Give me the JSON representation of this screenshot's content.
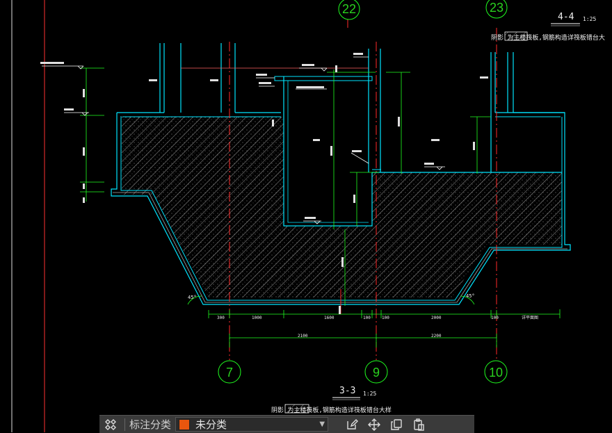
{
  "drawing": {
    "colors": {
      "background": "#000000",
      "concrete_outline": "#00ffff",
      "axis_line": "#ff2020",
      "dimension": "#20ff20",
      "axis_bubble": "#20ff20",
      "wall": "#00e5ff",
      "leader": "#ffffff"
    },
    "top_axes": [
      {
        "label": "22",
        "tag": "axis-22"
      },
      {
        "label": "23",
        "tag": "axis-23"
      }
    ],
    "bottom_axes": [
      {
        "label": "7",
        "tag": "axis-7"
      },
      {
        "label": "9",
        "tag": "axis-9"
      },
      {
        "label": "10",
        "tag": "axis-10"
      }
    ],
    "section_top": {
      "label": "4-4",
      "scale": "1:25"
    },
    "section_bottom": {
      "label": "3-3",
      "scale": "1:25"
    },
    "note_top": "阴影 为主楼筏板,钢筋构造详筏板错台大",
    "note_bottom": "阴影 为主楼筏板,钢筋构造详筏板错台大样",
    "bottom_dims_row1": [
      "300",
      "1000",
      "1600",
      "100",
      "100",
      "2000",
      "100"
    ],
    "bottom_dims_row2": [
      "2100",
      "2200"
    ],
    "slope_label": "45°",
    "dim_right_end": "详平面图"
  },
  "toolbar": {
    "category_label": "标注分类",
    "category_value": "未分类",
    "category_color": "#e8560e",
    "icons": [
      "cluster-icon",
      "edit-icon",
      "move-icon",
      "copy-icon",
      "paste-icon"
    ]
  }
}
